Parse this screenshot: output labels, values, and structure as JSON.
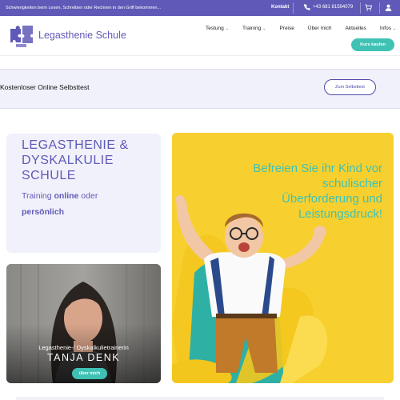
{
  "topbar": {
    "promo": "Schwierigkeiten beim Lesen, Schreiben oder Rechnen in den Griff bekommen...",
    "contact": "Kontakt",
    "phone": "+43 681 81594079",
    "phone_icon": "phone-icon",
    "cart_icon": "cart-icon",
    "user_icon": "user-icon"
  },
  "header": {
    "brand": "Legasthenie Schule",
    "logo_icon": "puzzle-logo-icon",
    "nav": [
      {
        "label": "Testung",
        "dropdown": true
      },
      {
        "label": "Training",
        "dropdown": true
      },
      {
        "label": "Preise",
        "dropdown": false
      },
      {
        "label": "Über mich",
        "dropdown": false
      },
      {
        "label": "Aktuelles",
        "dropdown": false
      },
      {
        "label": "Infos",
        "dropdown": true
      }
    ],
    "buy_button": "Kurs kaufen"
  },
  "selftest": {
    "label": "Kostenloser Online Selbsttest",
    "button": "Zum Selbsttest"
  },
  "intro": {
    "title_line1": "LEGASTHENIE &",
    "title_line2": "DYSKALKULIE",
    "title_line3": "SCHULE",
    "training_prefix": "Training ",
    "training_online": "online",
    "training_or": " oder",
    "training_personal": "persönlich"
  },
  "trainer": {
    "role": "Legasthenie-/ Dyskalkulietrainerin",
    "name": "TANJA DENK",
    "button": "über mich"
  },
  "hero": {
    "line1": "Befreien Sie ihr Kind vor",
    "line2": "schulischer",
    "line3": "Überforderung und",
    "line4": "Leistungsdruck!"
  },
  "colors": {
    "brand_purple": "#5f5ab7",
    "accent_teal": "#3fc2b4",
    "hero_yellow": "#f7d02f",
    "card_bg": "#f1f1fb"
  }
}
